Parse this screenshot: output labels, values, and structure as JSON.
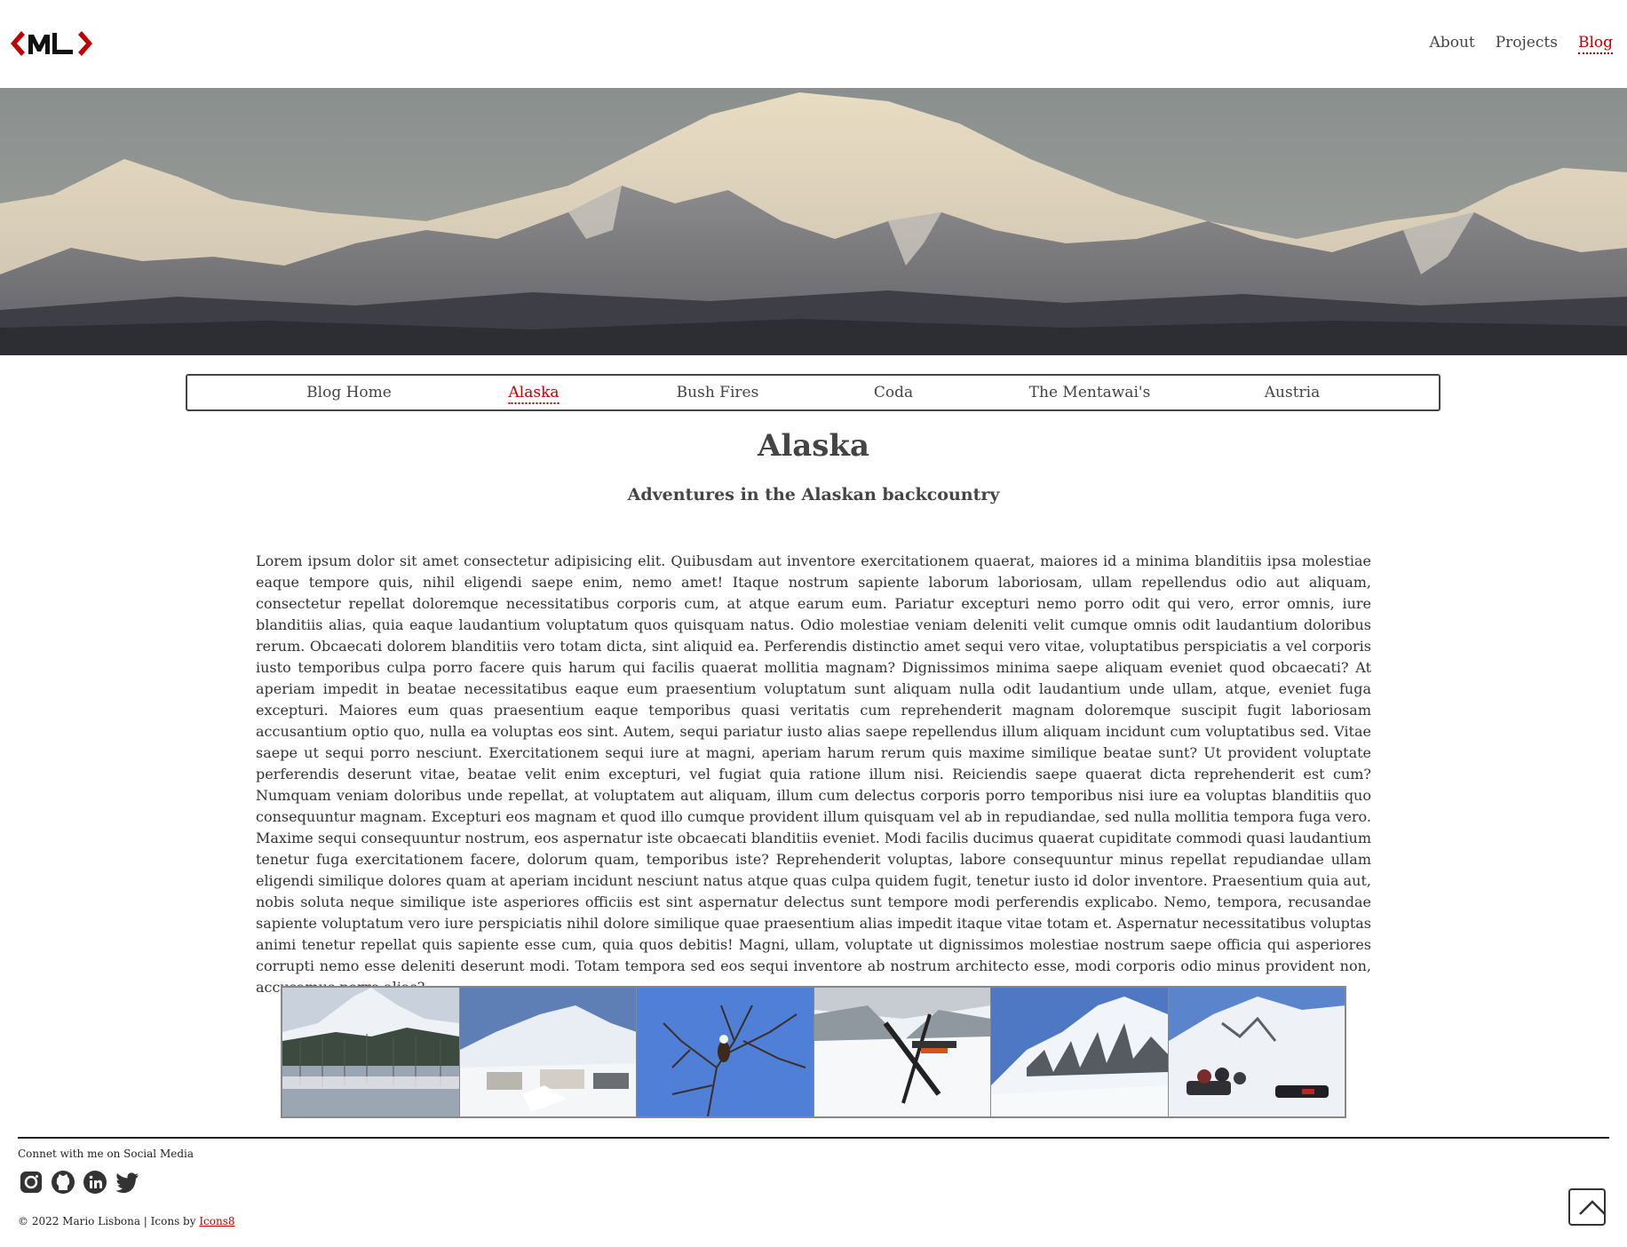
{
  "header": {
    "logo_alt": "ML",
    "nav": [
      {
        "label": "About",
        "active": false
      },
      {
        "label": "Projects",
        "active": false
      },
      {
        "label": "Blog",
        "active": true
      }
    ]
  },
  "hero": {
    "image": "mountain-landscape"
  },
  "subnav": {
    "items": [
      {
        "label": "Blog Home",
        "active": false
      },
      {
        "label": "Alaska",
        "active": true
      },
      {
        "label": "Bush Fires",
        "active": false
      },
      {
        "label": "Coda",
        "active": false
      },
      {
        "label": "The Mentawai's",
        "active": false
      },
      {
        "label": "Austria",
        "active": false
      }
    ]
  },
  "article": {
    "title": "Alaska",
    "subtitle": "Adventures in the Alaskan backcountry",
    "body": "Lorem ipsum dolor sit amet consectetur adipisicing elit. Quibusdam aut inventore exercitationem quaerat, maiores id a minima blanditiis ipsa molestiae eaque tempore quis, nihil eligendi saepe enim, nemo amet! Itaque nostrum sapiente laborum laboriosam, ullam repellendus odio aut aliquam, consectetur repellat doloremque necessitatibus corporis cum, at atque earum eum. Pariatur excepturi nemo porro odit qui vero, error omnis, iure blanditiis alias, quia eaque laudantium voluptatum quos quisquam natus. Odio molestiae veniam deleniti velit cumque omnis odit laudantium doloribus rerum. Obcaecati dolorem blanditiis vero totam dicta, sint aliquid ea. Perferendis distinctio amet sequi vero vitae, voluptatibus perspiciatis a vel corporis iusto temporibus culpa porro facere quis harum qui facilis quaerat mollitia magnam? Dignissimos minima saepe aliquam eveniet quod obcaecati? At aperiam impedit in beatae necessitatibus eaque eum praesentium voluptatum sunt aliquam nulla odit laudantium unde ullam, atque, eveniet fuga excepturi. Maiores eum quas praesentium eaque temporibus quasi veritatis cum reprehenderit magnam doloremque suscipit fugit laboriosam accusantium optio quo, nulla ea voluptas eos sint. Autem, sequi pariatur iusto alias saepe repellendus illum aliquam incidunt cum voluptatibus sed. Vitae saepe ut sequi porro nesciunt. Exercitationem sequi iure at magni, aperiam harum rerum quis maxime similique beatae sunt? Ut provident voluptate perferendis deserunt vitae, beatae velit enim excepturi, vel fugiat quia ratione illum nisi. Reiciendis saepe quaerat dicta reprehenderit est cum? Numquam veniam doloribus unde repellat, at voluptatem aut aliquam, illum cum delectus corporis porro temporibus nisi iure ea voluptas blanditiis quo consequuntur magnam. Excepturi eos magnam et quod illo cumque provident illum quisquam vel ab in repudiandae, sed nulla mollitia tempora fuga vero. Maxime sequi consequuntur nostrum, eos aspernatur iste obcaecati blanditiis eveniet. Modi facilis ducimus quaerat cupiditate commodi quasi laudantium tenetur fuga exercitationem facere, dolorum quam, temporibus iste? Reprehenderit voluptas, labore consequuntur minus repellat repudiandae ullam eligendi similique dolores quam at aperiam incidunt nesciunt natus atque quas culpa quidem fugit, tenetur iusto id dolor inventore. Praesentium quia aut, nobis soluta neque similique iste asperiores officiis est sint aspernatur delectus sunt tempore modi perferendis explicabo. Nemo, tempora, recusandae sapiente voluptatum vero iure perspiciatis nihil dolore similique quae praesentium alias impedit itaque vitae totam et. Aspernatur necessitatibus voluptas animi tenetur repellat quis sapiente esse cum, quia quos debitis! Magni, ullam, voluptate ut dignissimos molestiae nostrum saepe officia qui asperiores corrupti nemo esse deleniti deserunt modi. Totam tempora sed eos sequi inventore ab nostrum architecto esse, modi corporis odio minus provident non, accusamus porro alias?"
  },
  "gallery": {
    "photos": [
      "harbor-with-mountain",
      "camp-in-snow",
      "bald-eagle-in-tree",
      "plane-ski-view",
      "snowy-ridge",
      "snowmobile-group"
    ]
  },
  "footer": {
    "social_label": "Connet with me on Social Media",
    "social_icons": [
      "instagram-icon",
      "github-icon",
      "linkedin-icon",
      "twitter-icon"
    ],
    "copyright_text": "© 2022 Mario Lisbona | Icons by ",
    "icons_credit_link": "Icons8"
  },
  "colors": {
    "accent": "#c00000",
    "text": "#444444",
    "border": "#444444"
  }
}
